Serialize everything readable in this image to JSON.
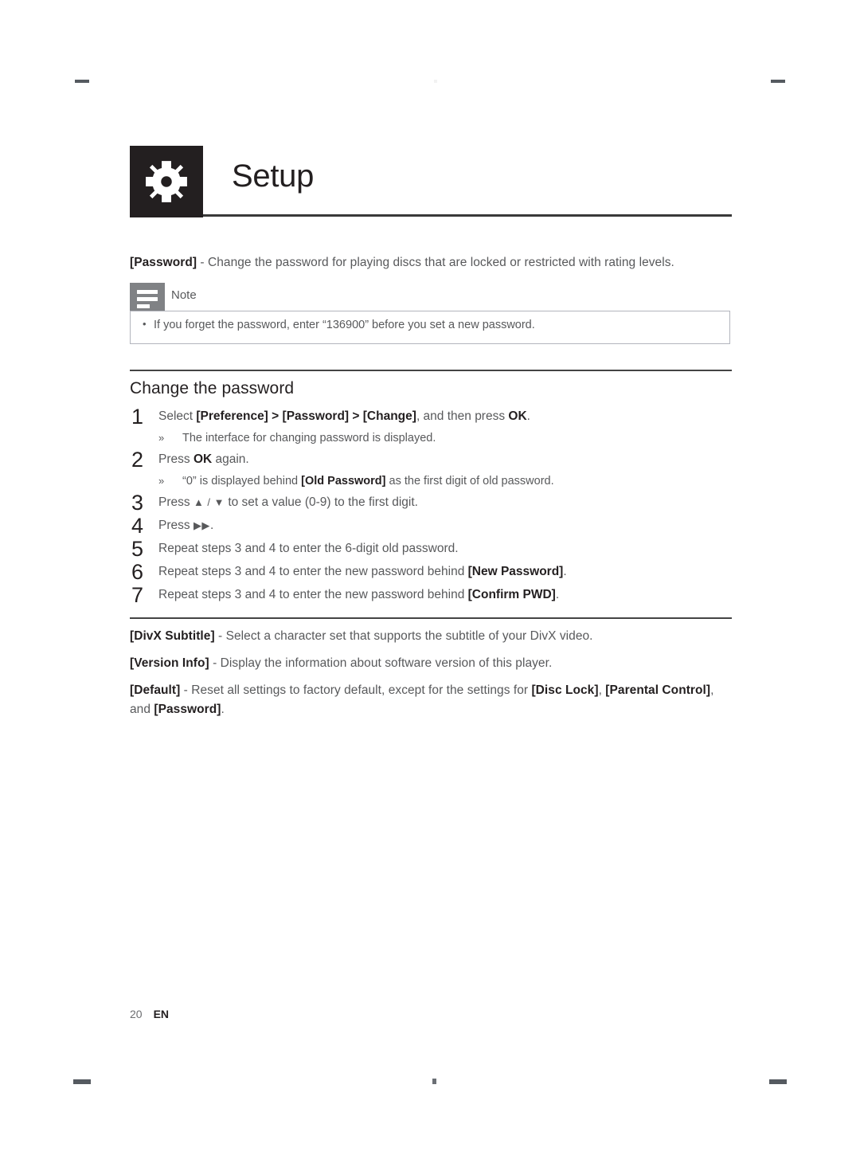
{
  "header": {
    "title": "Setup",
    "icon": "gear-icon"
  },
  "intro": {
    "term": "[Password]",
    "text": " - Change the password for playing discs that are locked or restricted with rating levels."
  },
  "note": {
    "label": "Note",
    "icon": "note-lines-icon",
    "bullet": "•",
    "items": [
      "If you forget the password, enter “136900” before you set a new password."
    ]
  },
  "section": {
    "heading": "Change the password",
    "steps": [
      {
        "num": "1",
        "parts": [
          {
            "t": "Select ",
            "b": false
          },
          {
            "t": "[Preference]",
            "b": true
          },
          {
            "t": " > ",
            "b": true
          },
          {
            "t": "[Password]",
            "b": true
          },
          {
            "t": " > ",
            "b": true
          },
          {
            "t": "[Change]",
            "b": true
          },
          {
            "t": ", and then press ",
            "b": false
          },
          {
            "t": "OK",
            "b": true
          },
          {
            "t": ".",
            "b": false
          }
        ],
        "sub": [
          {
            "marker": "»",
            "text": "The interface for changing password is displayed."
          }
        ]
      },
      {
        "num": "2",
        "parts": [
          {
            "t": "Press ",
            "b": false
          },
          {
            "t": "OK",
            "b": true
          },
          {
            "t": " again.",
            "b": false
          }
        ],
        "sub": [
          {
            "marker": "»",
            "pre": "“0” is displayed behind ",
            "bold": "[Old Password]",
            "post": " as the first digit of old password."
          }
        ]
      },
      {
        "num": "3",
        "parts": [
          {
            "t": "Press ",
            "b": false
          },
          {
            "t": "▲ / ▼",
            "b": false,
            "glyph": true
          },
          {
            "t": " to set a value (0-9) to the first digit.",
            "b": false
          }
        ],
        "sub": []
      },
      {
        "num": "4",
        "parts": [
          {
            "t": "Press ",
            "b": false
          },
          {
            "t": "▶▶",
            "b": false,
            "glyph": true
          },
          {
            "t": ".",
            "b": false
          }
        ],
        "sub": []
      },
      {
        "num": "5",
        "parts": [
          {
            "t": "Repeat steps 3 and 4 to enter the 6-digit old password.",
            "b": false
          }
        ],
        "sub": []
      },
      {
        "num": "6",
        "parts": [
          {
            "t": "Repeat steps 3 and 4 to enter the new password behind ",
            "b": false
          },
          {
            "t": "[New Password]",
            "b": true
          },
          {
            "t": ".",
            "b": false
          }
        ],
        "sub": []
      },
      {
        "num": "7",
        "parts": [
          {
            "t": "Repeat steps 3 and 4 to enter the new password behind ",
            "b": false
          },
          {
            "t": "[Confirm PWD]",
            "b": true
          },
          {
            "t": ".",
            "b": false
          }
        ],
        "sub": []
      }
    ]
  },
  "tail_paragraphs": [
    {
      "parts": [
        {
          "t": "[DivX Subtitle]",
          "b": true
        },
        {
          "t": " - Select a character set that supports the subtitle of your DivX video.",
          "b": false
        }
      ]
    },
    {
      "parts": [
        {
          "t": "[Version Info]",
          "b": true
        },
        {
          "t": " - Display the information about software version of this player.",
          "b": false
        }
      ]
    },
    {
      "parts": [
        {
          "t": "[Default]",
          "b": true
        },
        {
          "t": " - Reset all settings to factory default, except for the settings for ",
          "b": false
        },
        {
          "t": "[Disc Lock]",
          "b": true
        },
        {
          "t": ", ",
          "b": false
        },
        {
          "t": "[Parental Control]",
          "b": true
        },
        {
          "t": ", and ",
          "b": false
        },
        {
          "t": "[Password]",
          "b": true
        },
        {
          "t": ".",
          "b": false
        }
      ]
    }
  ],
  "footer": {
    "page": "20",
    "language": "EN"
  },
  "colors": {
    "icon_box": "#231f20",
    "note_tab": "#808285",
    "note_border": "#b3b5bd",
    "body_text": "#58595b",
    "bold_text": "#231f20"
  }
}
